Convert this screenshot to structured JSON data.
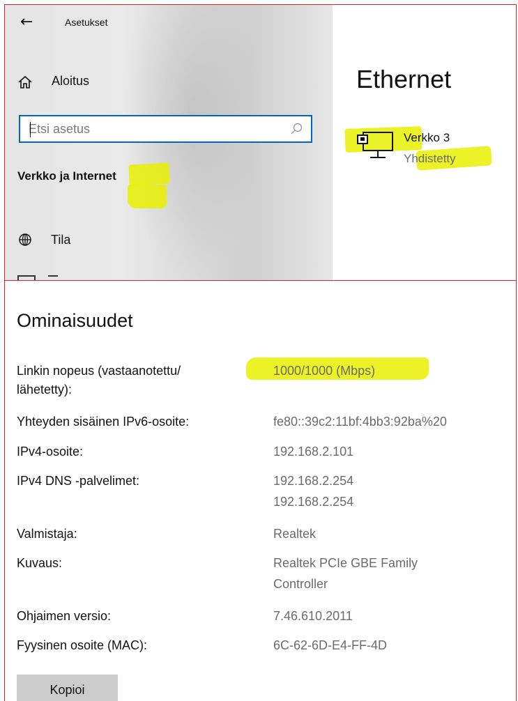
{
  "window": {
    "back_glyph": "←",
    "title": "Asetukset"
  },
  "sidebar": {
    "home_label": "Aloitus",
    "search_placeholder": "Etsi asetus",
    "section_heading": "Verkko ja Internet",
    "items": [
      {
        "label": "Tila",
        "icon": "globe-icon"
      }
    ]
  },
  "main": {
    "page_title": "Ethernet",
    "network": {
      "name": "Verkko 3",
      "status": "Yhdistetty",
      "icon": "ethernet-monitor-icon"
    }
  },
  "properties": {
    "title": "Ominaisuudet",
    "rows": [
      {
        "label": "Linkin nopeus (vastaanotettu/",
        "label2": "lähetetty):",
        "value": "1000/1000 (Mbps)"
      },
      {
        "label": "Yhteyden sisäinen IPv6-osoite:",
        "value": "fe80::39c2:11bf:4bb3:92ba%20"
      },
      {
        "label": "IPv4-osoite:",
        "value": "192.168.2.101"
      },
      {
        "label": "IPv4 DNS -palvelimet:",
        "value": "192.168.2.254",
        "value2": "192.168.2.254"
      },
      {
        "label": "Valmistaja:",
        "value": "Realtek"
      },
      {
        "label": "Kuvaus:",
        "value": "Realtek PCIe GBE Family",
        "value2": "Controller"
      },
      {
        "label": "Ohjaimen versio:",
        "value": "7.46.610.2011"
      },
      {
        "label": "Fyysinen osoite (MAC):",
        "value": "6C-62-6D-E4-FF-4D"
      }
    ],
    "copy_button": "Kopioi"
  },
  "colors": {
    "highlight": "#e8f000",
    "accent": "#0067c0",
    "crop_border": "#d8232a",
    "secondary_text": "#6b6b6b"
  }
}
